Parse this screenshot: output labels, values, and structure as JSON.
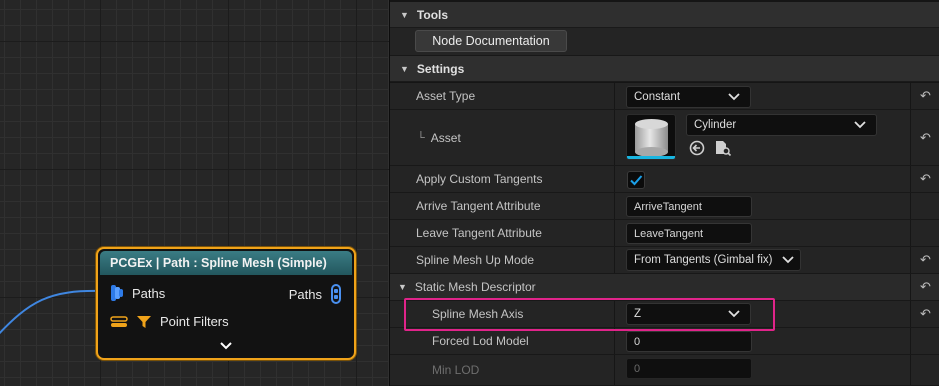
{
  "node": {
    "title": "PCGEx | Path : Spline Mesh (Simple)",
    "input_pin_label": "Paths",
    "output_pin_label": "Paths",
    "filter_pin_label": "Point Filters",
    "accent_color": "#f0a31a",
    "header_color": "#2f6b72"
  },
  "panel": {
    "tools": {
      "title": "Tools",
      "node_doc_button": "Node Documentation"
    },
    "settings": {
      "title": "Settings",
      "asset_type": {
        "label": "Asset Type",
        "value": "Constant"
      },
      "asset": {
        "label": "Asset",
        "value": "Cylinder"
      },
      "apply_custom_tangents": {
        "label": "Apply Custom Tangents",
        "checked": true
      },
      "arrive_tangent": {
        "label": "Arrive Tangent Attribute",
        "value": "ArriveTangent"
      },
      "leave_tangent": {
        "label": "Leave Tangent Attribute",
        "value": "LeaveTangent"
      },
      "up_mode": {
        "label": "Spline Mesh Up Mode",
        "value": "From Tangents (Gimbal fix)"
      }
    },
    "static_mesh": {
      "title": "Static Mesh Descriptor",
      "axis": {
        "label": "Spline Mesh Axis",
        "value": "Z"
      },
      "forced_lod": {
        "label": "Forced Lod Model",
        "value": "0"
      },
      "min_lod": {
        "label": "Min LOD",
        "value": "0"
      }
    },
    "highlight_color": "#e0248a",
    "check_color": "#1a9fe8"
  }
}
